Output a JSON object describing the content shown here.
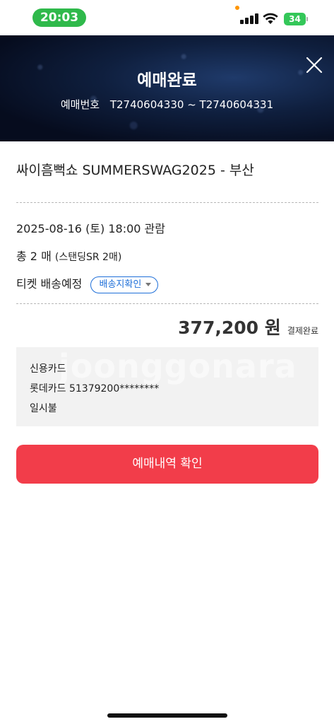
{
  "status_bar": {
    "time": "20:03",
    "battery": "34",
    "icons": [
      "signal-icon",
      "wifi-icon",
      "battery-icon"
    ],
    "colors": {
      "time_pill": "#2fb94b",
      "battery": "#34c759"
    }
  },
  "header": {
    "title": "예매완료",
    "booking_number_label": "예매번호",
    "booking_number_value": "T2740604330 ~ T2740604331",
    "close_icon": "close-icon"
  },
  "event": {
    "title": "싸이흠뻑쇼 SUMMERSWAG2025 - 부산"
  },
  "details": {
    "datetime": "2025-08-16 (토) 18:00 관람",
    "quantity_main": "총 2 매",
    "quantity_detail": "(스탠딩SR 2매)",
    "ticket_delivery_label": "티켓 배송예정",
    "delivery_button_label": "배송지확인"
  },
  "payment": {
    "amount": "377,200 원",
    "status": "결제완료",
    "method": "신용카드",
    "card": "롯데카드 51379200********",
    "installment": "일시불",
    "watermark": "joonggonara"
  },
  "actions": {
    "confirm_label": "예매내역 확인",
    "confirm_color": "#f23d4a"
  }
}
